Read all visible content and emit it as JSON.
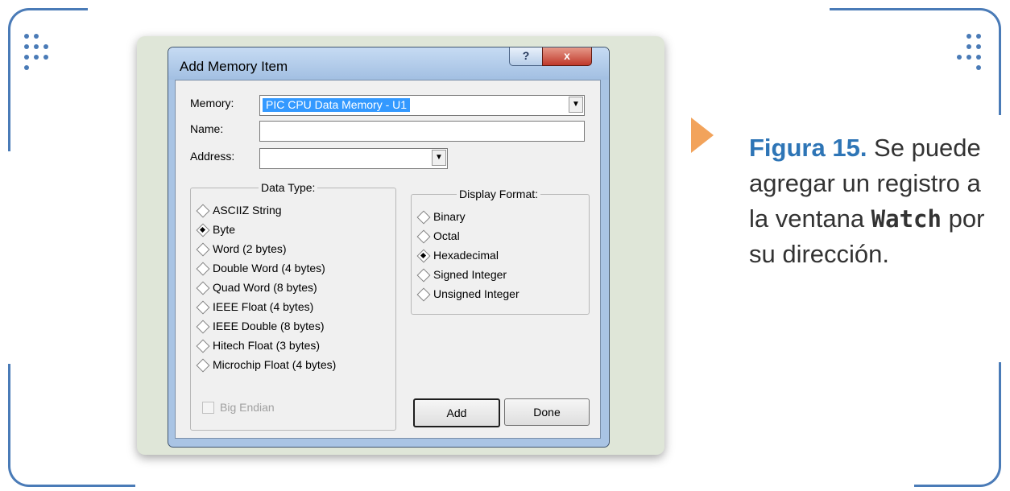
{
  "window": {
    "title": "Add Memory Item",
    "help_label": "?",
    "close_label": "x"
  },
  "form": {
    "memory_label": "Memory:",
    "memory_value": "PIC CPU Data Memory - U1",
    "name_label": "Name:",
    "name_value": "",
    "address_label": "Address:",
    "address_value": ""
  },
  "data_type": {
    "title": "Data Type:",
    "options": [
      {
        "label": "ASCIIZ String",
        "selected": false
      },
      {
        "label": "Byte",
        "selected": true
      },
      {
        "label": "Word (2 bytes)",
        "selected": false
      },
      {
        "label": "Double Word (4 bytes)",
        "selected": false
      },
      {
        "label": "Quad Word (8 bytes)",
        "selected": false
      },
      {
        "label": "IEEE Float (4 bytes)",
        "selected": false
      },
      {
        "label": "IEEE Double (8 bytes)",
        "selected": false
      },
      {
        "label": "Hitech Float (3 bytes)",
        "selected": false
      },
      {
        "label": "Microchip Float (4 bytes)",
        "selected": false
      }
    ],
    "big_endian_label": "Big Endian",
    "big_endian_checked": false
  },
  "display_format": {
    "title": "Display Format:",
    "options": [
      {
        "label": "Binary",
        "selected": false
      },
      {
        "label": "Octal",
        "selected": false
      },
      {
        "label": "Hexadecimal",
        "selected": true
      },
      {
        "label": "Signed Integer",
        "selected": false
      },
      {
        "label": "Unsigned Integer",
        "selected": false
      }
    ]
  },
  "buttons": {
    "add_label": "Add",
    "done_label": "Done"
  },
  "caption": {
    "figure_label": "Figura 15.",
    "text_1": " Se puede agregar un registro a la ventana ",
    "code": "Watch",
    "text_2": " por su dirección."
  },
  "colors": {
    "accent": "#2e75b6",
    "frame": "#4a7bb7",
    "arrow": "#f2a35b",
    "selection": "#3399ff"
  }
}
